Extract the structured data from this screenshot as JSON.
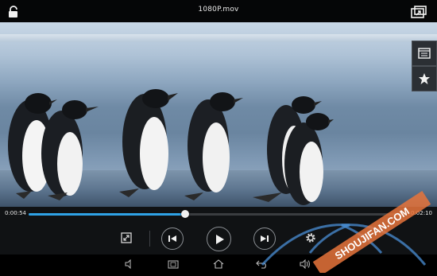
{
  "window": {
    "title": "1080P.mov"
  },
  "icons": {
    "lock": "unlock-icon",
    "rotate": "screen-rotate-icon",
    "playlist": "video-list-icon",
    "favorite": "star-icon",
    "fullscreen": "resize-icon",
    "previous": "skip-previous-icon",
    "play": "play-icon",
    "next": "skip-next-icon",
    "settings": "gear-icon"
  },
  "playback": {
    "current_time": "0:00:54",
    "total_time": "0:02:10",
    "progress": 0.415
  },
  "navbar": {
    "items": [
      "volume-down-icon",
      "screenshot-icon",
      "home-icon",
      "back-icon",
      "volume-up-icon"
    ]
  },
  "watermark": {
    "text": "SHOUJIFAN.COM"
  },
  "colors": {
    "progress_fill": "#2fa2e6",
    "titlebar_bg": "#050607",
    "controls_bg": "#101214"
  }
}
